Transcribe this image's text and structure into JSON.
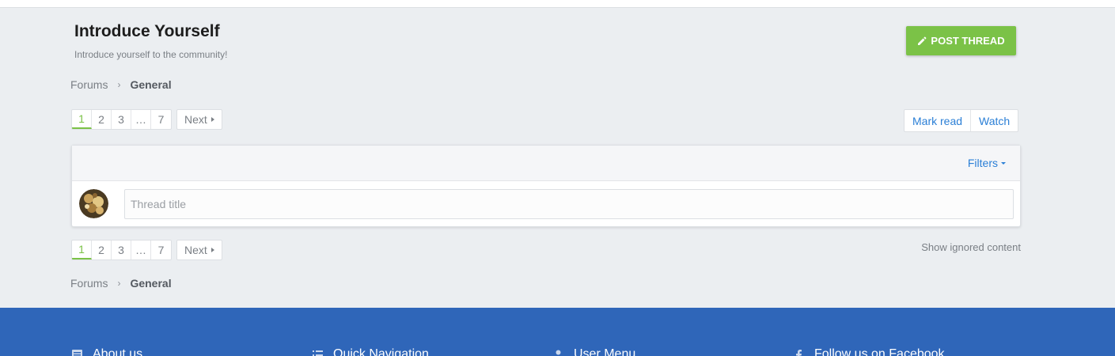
{
  "header": {
    "title": "Introduce Yourself",
    "description": "Introduce yourself to the community!",
    "post_thread_label": "POST THREAD"
  },
  "breadcrumb": {
    "root": "Forums",
    "separator": "›",
    "current": "General"
  },
  "pagination": {
    "pages": [
      "1",
      "2",
      "3",
      "…",
      "7"
    ],
    "current": "1",
    "next_label": "Next"
  },
  "actions": {
    "mark_read": "Mark read",
    "watch": "Watch"
  },
  "panel": {
    "filters_label": "Filters",
    "thread_placeholder": "Thread title"
  },
  "show_ignored_label": "Show ignored content",
  "footer": {
    "columns": [
      {
        "label": "About us",
        "icon": "document-icon"
      },
      {
        "label": "Quick Navigation",
        "icon": "list-icon"
      },
      {
        "label": "User Menu",
        "icon": "user-icon"
      },
      {
        "label": "Follow us on Facebook",
        "icon": "facebook-icon"
      }
    ]
  },
  "colors": {
    "accent_green": "#7bc247",
    "link_blue": "#2b7fd6",
    "footer_blue": "#2f66b9",
    "background": "#ebeef1"
  }
}
